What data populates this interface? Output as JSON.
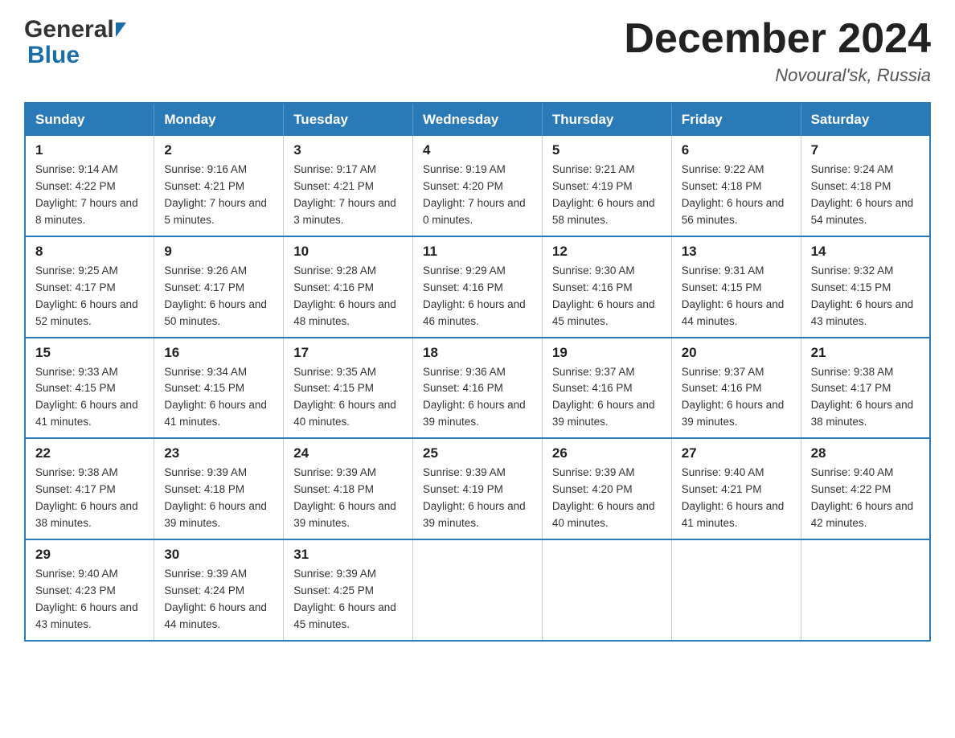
{
  "header": {
    "title": "December 2024",
    "location": "Novoural'sk, Russia",
    "logo_general": "General",
    "logo_blue": "Blue"
  },
  "weekdays": [
    "Sunday",
    "Monday",
    "Tuesday",
    "Wednesday",
    "Thursday",
    "Friday",
    "Saturday"
  ],
  "weeks": [
    [
      {
        "day": "1",
        "sunrise": "9:14 AM",
        "sunset": "4:22 PM",
        "daylight": "7 hours and 8 minutes."
      },
      {
        "day": "2",
        "sunrise": "9:16 AM",
        "sunset": "4:21 PM",
        "daylight": "7 hours and 5 minutes."
      },
      {
        "day": "3",
        "sunrise": "9:17 AM",
        "sunset": "4:21 PM",
        "daylight": "7 hours and 3 minutes."
      },
      {
        "day": "4",
        "sunrise": "9:19 AM",
        "sunset": "4:20 PM",
        "daylight": "7 hours and 0 minutes."
      },
      {
        "day": "5",
        "sunrise": "9:21 AM",
        "sunset": "4:19 PM",
        "daylight": "6 hours and 58 minutes."
      },
      {
        "day": "6",
        "sunrise": "9:22 AM",
        "sunset": "4:18 PM",
        "daylight": "6 hours and 56 minutes."
      },
      {
        "day": "7",
        "sunrise": "9:24 AM",
        "sunset": "4:18 PM",
        "daylight": "6 hours and 54 minutes."
      }
    ],
    [
      {
        "day": "8",
        "sunrise": "9:25 AM",
        "sunset": "4:17 PM",
        "daylight": "6 hours and 52 minutes."
      },
      {
        "day": "9",
        "sunrise": "9:26 AM",
        "sunset": "4:17 PM",
        "daylight": "6 hours and 50 minutes."
      },
      {
        "day": "10",
        "sunrise": "9:28 AM",
        "sunset": "4:16 PM",
        "daylight": "6 hours and 48 minutes."
      },
      {
        "day": "11",
        "sunrise": "9:29 AM",
        "sunset": "4:16 PM",
        "daylight": "6 hours and 46 minutes."
      },
      {
        "day": "12",
        "sunrise": "9:30 AM",
        "sunset": "4:16 PM",
        "daylight": "6 hours and 45 minutes."
      },
      {
        "day": "13",
        "sunrise": "9:31 AM",
        "sunset": "4:15 PM",
        "daylight": "6 hours and 44 minutes."
      },
      {
        "day": "14",
        "sunrise": "9:32 AM",
        "sunset": "4:15 PM",
        "daylight": "6 hours and 43 minutes."
      }
    ],
    [
      {
        "day": "15",
        "sunrise": "9:33 AM",
        "sunset": "4:15 PM",
        "daylight": "6 hours and 41 minutes."
      },
      {
        "day": "16",
        "sunrise": "9:34 AM",
        "sunset": "4:15 PM",
        "daylight": "6 hours and 41 minutes."
      },
      {
        "day": "17",
        "sunrise": "9:35 AM",
        "sunset": "4:15 PM",
        "daylight": "6 hours and 40 minutes."
      },
      {
        "day": "18",
        "sunrise": "9:36 AM",
        "sunset": "4:16 PM",
        "daylight": "6 hours and 39 minutes."
      },
      {
        "day": "19",
        "sunrise": "9:37 AM",
        "sunset": "4:16 PM",
        "daylight": "6 hours and 39 minutes."
      },
      {
        "day": "20",
        "sunrise": "9:37 AM",
        "sunset": "4:16 PM",
        "daylight": "6 hours and 39 minutes."
      },
      {
        "day": "21",
        "sunrise": "9:38 AM",
        "sunset": "4:17 PM",
        "daylight": "6 hours and 38 minutes."
      }
    ],
    [
      {
        "day": "22",
        "sunrise": "9:38 AM",
        "sunset": "4:17 PM",
        "daylight": "6 hours and 38 minutes."
      },
      {
        "day": "23",
        "sunrise": "9:39 AM",
        "sunset": "4:18 PM",
        "daylight": "6 hours and 39 minutes."
      },
      {
        "day": "24",
        "sunrise": "9:39 AM",
        "sunset": "4:18 PM",
        "daylight": "6 hours and 39 minutes."
      },
      {
        "day": "25",
        "sunrise": "9:39 AM",
        "sunset": "4:19 PM",
        "daylight": "6 hours and 39 minutes."
      },
      {
        "day": "26",
        "sunrise": "9:39 AM",
        "sunset": "4:20 PM",
        "daylight": "6 hours and 40 minutes."
      },
      {
        "day": "27",
        "sunrise": "9:40 AM",
        "sunset": "4:21 PM",
        "daylight": "6 hours and 41 minutes."
      },
      {
        "day": "28",
        "sunrise": "9:40 AM",
        "sunset": "4:22 PM",
        "daylight": "6 hours and 42 minutes."
      }
    ],
    [
      {
        "day": "29",
        "sunrise": "9:40 AM",
        "sunset": "4:23 PM",
        "daylight": "6 hours and 43 minutes."
      },
      {
        "day": "30",
        "sunrise": "9:39 AM",
        "sunset": "4:24 PM",
        "daylight": "6 hours and 44 minutes."
      },
      {
        "day": "31",
        "sunrise": "9:39 AM",
        "sunset": "4:25 PM",
        "daylight": "6 hours and 45 minutes."
      },
      null,
      null,
      null,
      null
    ]
  ],
  "labels": {
    "sunrise": "Sunrise:",
    "sunset": "Sunset:",
    "daylight": "Daylight:"
  }
}
